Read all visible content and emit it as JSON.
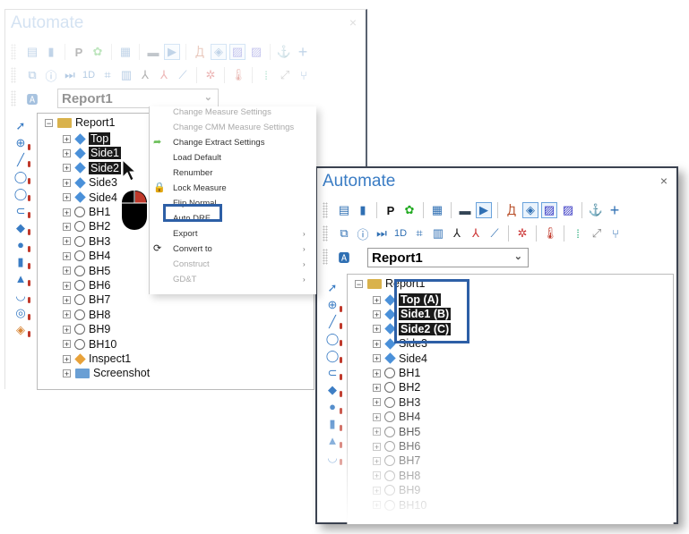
{
  "left_panel": {
    "title": "Automate",
    "close_label": "×",
    "combo_value": "Report1",
    "tree": {
      "root": "Report1",
      "items": [
        {
          "label": "Top",
          "type": "plane",
          "selected": true
        },
        {
          "label": "Side1",
          "type": "plane",
          "selected": true
        },
        {
          "label": "Side2",
          "type": "plane",
          "selected": true
        },
        {
          "label": "Side3",
          "type": "plane",
          "selected": false
        },
        {
          "label": "Side4",
          "type": "plane",
          "selected": false
        },
        {
          "label": "BH1",
          "type": "circle"
        },
        {
          "label": "BH2",
          "type": "circle"
        },
        {
          "label": "BH3",
          "type": "circle"
        },
        {
          "label": "BH4",
          "type": "circle"
        },
        {
          "label": "BH5",
          "type": "circle"
        },
        {
          "label": "BH6",
          "type": "circle"
        },
        {
          "label": "BH7",
          "type": "circle"
        },
        {
          "label": "BH8",
          "type": "circle"
        },
        {
          "label": "BH9",
          "type": "circle"
        },
        {
          "label": "BH10",
          "type": "circle"
        },
        {
          "label": "Inspect1",
          "type": "inspect"
        },
        {
          "label": "Screenshot",
          "type": "screenshot"
        }
      ]
    },
    "context_menu": [
      {
        "label": "Change Measure Settings",
        "disabled": true
      },
      {
        "label": "Change CMM Measure Settings",
        "disabled": true
      },
      {
        "label": "Change Extract Settings",
        "disabled": false,
        "icon": "green-arrow-icon"
      },
      {
        "label": "Load Default",
        "disabled": false
      },
      {
        "label": "Renumber",
        "disabled": false
      },
      {
        "label": "Lock Measure",
        "disabled": false,
        "icon": "lock-icon"
      },
      {
        "label": "Flip Normal",
        "disabled": false
      },
      {
        "label": "Auto DRF",
        "disabled": false,
        "highlighted": true
      },
      {
        "label": "Export",
        "disabled": false,
        "submenu": true
      },
      {
        "label": "Convert to",
        "disabled": false,
        "submenu": true,
        "icon": "convert-icon"
      },
      {
        "label": "Construct",
        "disabled": true,
        "submenu": true
      },
      {
        "label": "GD&T",
        "disabled": true,
        "submenu": true
      }
    ],
    "submenu_arrow": "›"
  },
  "right_panel": {
    "title": "Automate",
    "close_label": "×",
    "combo_value": "Report1",
    "tree": {
      "root": "Report1",
      "items": [
        {
          "label": "Top (A)",
          "type": "plane",
          "selected": true
        },
        {
          "label": "Side1 (B)",
          "type": "plane",
          "selected": true
        },
        {
          "label": "Side2 (C)",
          "type": "plane",
          "selected": true
        },
        {
          "label": "Side3",
          "type": "plane"
        },
        {
          "label": "Side4",
          "type": "plane"
        },
        {
          "label": "BH1",
          "type": "circle"
        },
        {
          "label": "BH2",
          "type": "circle"
        },
        {
          "label": "BH3",
          "type": "circle"
        },
        {
          "label": "BH4",
          "type": "circle"
        },
        {
          "label": "BH5",
          "type": "circle"
        },
        {
          "label": "BH6",
          "type": "circle"
        },
        {
          "label": "BH7",
          "type": "circle"
        },
        {
          "label": "BH8",
          "type": "circle"
        },
        {
          "label": "BH9",
          "type": "circle"
        },
        {
          "label": "BH10",
          "type": "circle"
        }
      ]
    }
  },
  "toolbar_row1": [
    "report-icon",
    "book-icon",
    "P",
    "probe-icon",
    "sheet-icon",
    "window-icon",
    "play-icon",
    "robot-icon",
    "tag-icon",
    "hatch-icon",
    "hatch-color-icon",
    "anchor-icon",
    "plus-icon"
  ],
  "toolbar_row2": [
    "screenshot-icon",
    "info-icon",
    "step-icon",
    "1D",
    "cmm-icon",
    "table-icon",
    "axis-icon",
    "axis2-icon",
    "chart-icon",
    "align-icon",
    "thermometer-icon",
    "grid-icon",
    "vector-icon",
    "branch-icon"
  ],
  "glyphs": {
    "P": "P",
    "1D": "1D",
    "expand": "+",
    "collapse": "−",
    "chevron": "⌄"
  }
}
